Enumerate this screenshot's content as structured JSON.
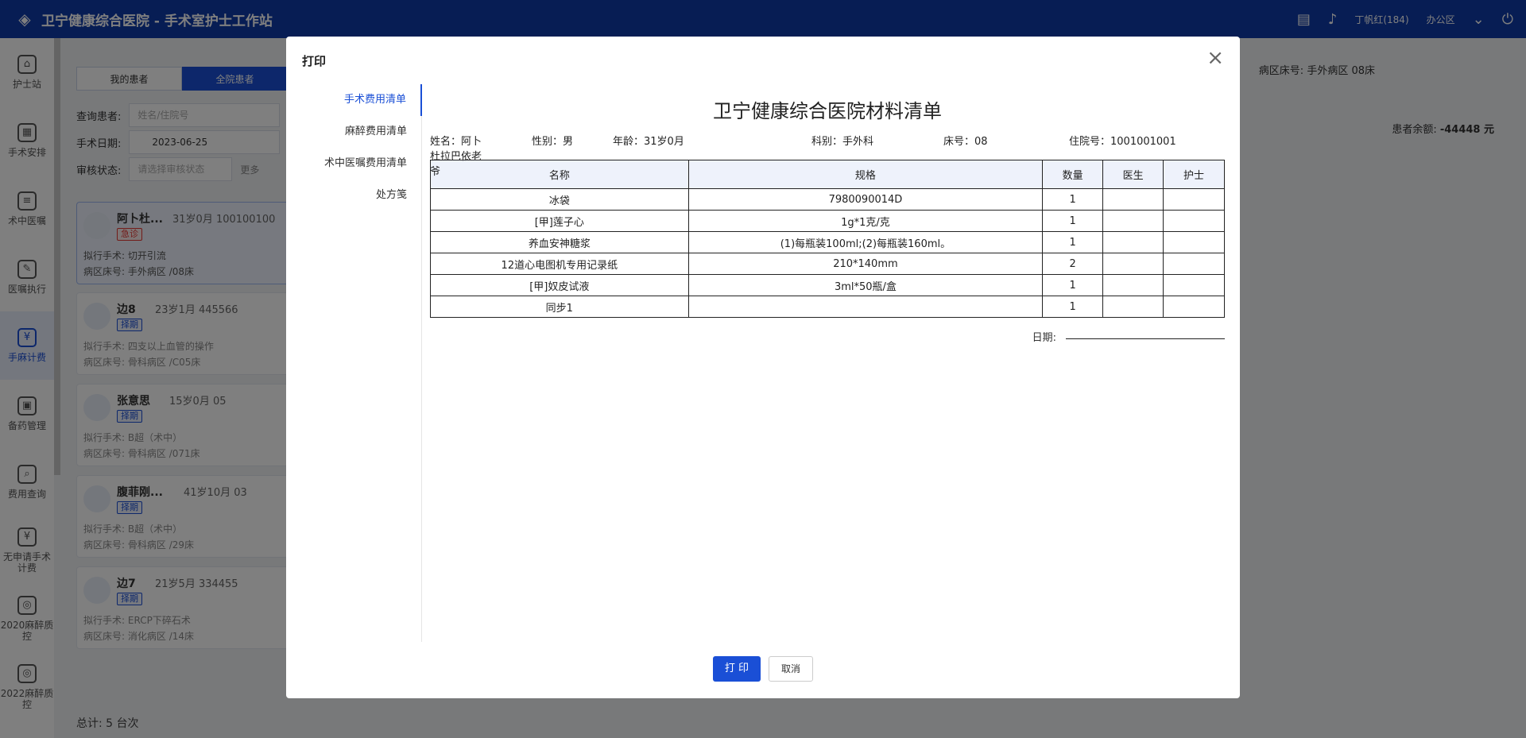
{
  "app": {
    "title": "卫宁健康综合医院 - 手术室护士工作站",
    "user": "丁帆红(184)",
    "dept": "办公区"
  },
  "sidebar": {
    "items": [
      {
        "label": "护士站",
        "icon": "home-icon"
      },
      {
        "label": "手术安排",
        "icon": "calendar-icon"
      },
      {
        "label": "术中医嘱",
        "icon": "document-icon"
      },
      {
        "label": "医嘱执行",
        "icon": "edit-doc-icon"
      },
      {
        "label": "手麻计费",
        "icon": "yuan-icon"
      },
      {
        "label": "备药管理",
        "icon": "medicine-icon"
      },
      {
        "label": "费用查询",
        "icon": "search-money-icon"
      },
      {
        "label": "无申请手术计费",
        "icon": "yuan-doc-icon"
      },
      {
        "label": "2020麻醉质控",
        "icon": "shield-icon"
      },
      {
        "label": "2022麻醉质控",
        "icon": "shield-icon"
      }
    ]
  },
  "left": {
    "tabs": [
      "我的患者",
      "全院患者"
    ],
    "query_label": "查询患者:",
    "query_placeholder": "姓名/住院号",
    "date_label": "手术日期:",
    "date_value": "2023-06-25",
    "audit_label": "审核状态:",
    "audit_placeholder": "请选择审核状态",
    "more": "更多",
    "patients": [
      {
        "name": "阿卜杜...",
        "info": "31岁0月   100100100",
        "tag": "急诊",
        "surgery_label": "拟行手术:",
        "surgery": "切开引流",
        "bed_label": "病区床号:",
        "bed": "手外病区 /08床"
      },
      {
        "name": "边8",
        "info": "23岁1月   445566",
        "tag": "择期",
        "surgery_label": "拟行手术:",
        "surgery": "四支以上血管的操作",
        "bed_label": "病区床号:",
        "bed": "骨科病区 /C05床"
      },
      {
        "name": "张意思",
        "info": "15岁0月   05",
        "tag": "择期",
        "surgery_label": "拟行手术:",
        "surgery": "B超（术中）",
        "bed_label": "病区床号:",
        "bed": "骨科病区 /071床"
      },
      {
        "name": "腹菲刚...",
        "info": "41岁10月   03",
        "tag": "择期",
        "surgery_label": "拟行手术:",
        "surgery": "B超（术中）",
        "bed_label": "病区床号:",
        "bed": "骨科病区 /29床"
      },
      {
        "name": "边7",
        "info": "21岁5月   334455",
        "tag": "择期",
        "surgery_label": "拟行手术:",
        "surgery": "ERCP下碎石术",
        "bed_label": "病区床号:",
        "bed": "消化病区 /14床"
      }
    ],
    "total": "总计:  5 台次"
  },
  "right": {
    "bed_label": "病区床号:",
    "bed": "手外病区 08床",
    "balance_label": "患者余额:",
    "balance": "-44448 元"
  },
  "modal": {
    "title": "打印",
    "tabs": [
      "手术费用清单",
      "麻醉费用清单",
      "术中医嘱费用清单",
      "处方笺"
    ],
    "doc": {
      "title": "卫宁健康综合医院材料清单",
      "name": "姓名：阿卜杜拉巴依老爷",
      "sex": "性别：男",
      "age": "年龄：31岁0月",
      "dept": "科别：手外科",
      "bed": "床号：08",
      "inpatient_no": "住院号：1001001001",
      "columns": [
        "名称",
        "规格",
        "数量",
        "医生",
        "护士"
      ],
      "rows": [
        [
          "冰袋",
          "7980090014D",
          "1",
          "",
          ""
        ],
        [
          "[甲]莲子心",
          "1g*1克/克",
          "1",
          "",
          ""
        ],
        [
          "养血安神糖浆",
          "(1)每瓶装100ml;(2)每瓶装160ml。",
          "1",
          "",
          ""
        ],
        [
          "12道心电图机专用记录纸",
          "210*140mm",
          "2",
          "",
          ""
        ],
        [
          "[甲]奴皮试液",
          "3ml*50瓶/盒",
          "1",
          "",
          ""
        ],
        [
          "同步1",
          "",
          "1",
          "",
          ""
        ]
      ],
      "date_label": "日期:"
    },
    "print_btn": "打 印",
    "cancel_btn": "取消"
  }
}
